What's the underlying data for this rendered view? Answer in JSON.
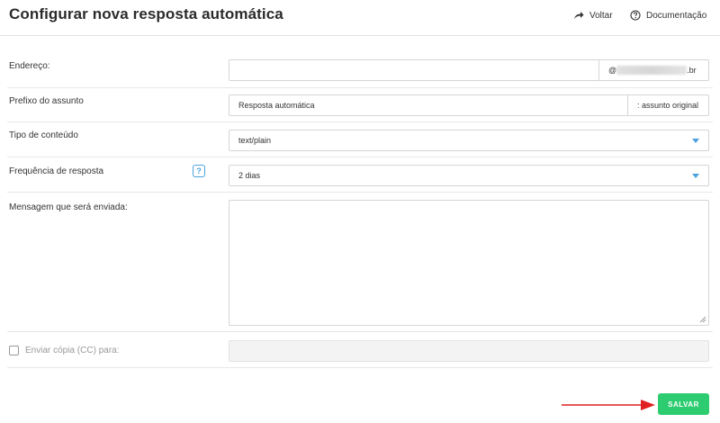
{
  "header": {
    "title": "Configurar nova resposta automática",
    "back_label": "Voltar",
    "docs_label": "Documentação"
  },
  "form": {
    "address": {
      "label": "Endereço:",
      "value": "",
      "domain_prefix": "@",
      "domain_suffix": ".br"
    },
    "subject_prefix": {
      "label": "Prefixo do assunto",
      "value": "Resposta automática",
      "addon": ": assunto original"
    },
    "content_type": {
      "label": "Tipo de conteúdo",
      "value": "text/plain"
    },
    "frequency": {
      "label": "Frequência de resposta",
      "help": "?",
      "value": "2 dias"
    },
    "message": {
      "label": "Mensagem que será enviada:",
      "value": ""
    },
    "cc": {
      "label": "Enviar cópia (CC) para:",
      "checked": false,
      "value": ""
    }
  },
  "actions": {
    "save_label": "SALVAR"
  },
  "colors": {
    "accent_blue": "#4aa3df",
    "save_green": "#2ecc71",
    "annotation_red": "#e02020"
  },
  "icons": {
    "back": "share-arrow-icon",
    "docs": "question-circle-icon",
    "dropdown": "caret-down-icon"
  }
}
